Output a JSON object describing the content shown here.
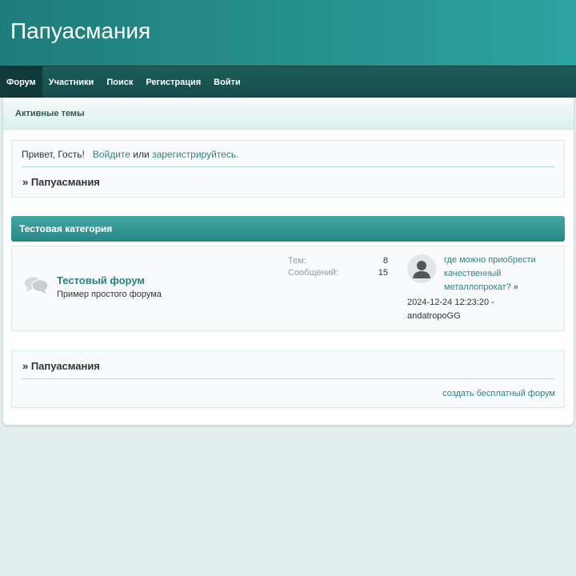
{
  "header": {
    "title": "Папуасмания"
  },
  "nav": {
    "items": [
      {
        "label": "Форум"
      },
      {
        "label": "Участники"
      },
      {
        "label": "Поиск"
      },
      {
        "label": "Регистрация"
      },
      {
        "label": "Войти"
      }
    ]
  },
  "subnav": {
    "active_topics": "Активные темы"
  },
  "welcome": {
    "greeting": "Привет, Гость!",
    "login_link": "Войдите",
    "or": "или",
    "register_link": "зарегистрируйтесь.",
    "breadcrumb": "» Папуасмания"
  },
  "category": {
    "title": "Тестовая категория",
    "forums": [
      {
        "name": "Тестовый форум",
        "description": "Пример простого форума",
        "topics_label": "Тем:",
        "topics": "8",
        "posts_label": "Сообщений:",
        "posts": "15",
        "last_post_title": "где можно приобрести качественный металлопрокат?",
        "last_post_arrow": "»",
        "last_post_date": "2024-12-24 12:23:20 -",
        "last_post_author": "andatropoGG"
      }
    ]
  },
  "footer": {
    "breadcrumb": "» Папуасмания",
    "link": "создать бесплатный форум"
  },
  "colors": {
    "header": "#2ba3a0",
    "nav": "#1c5c5a",
    "link": "#2b8582",
    "background": "#e3efed"
  },
  "icons": {
    "forum": "speech-bubbles-icon",
    "avatar": "user-silhouette-icon"
  }
}
